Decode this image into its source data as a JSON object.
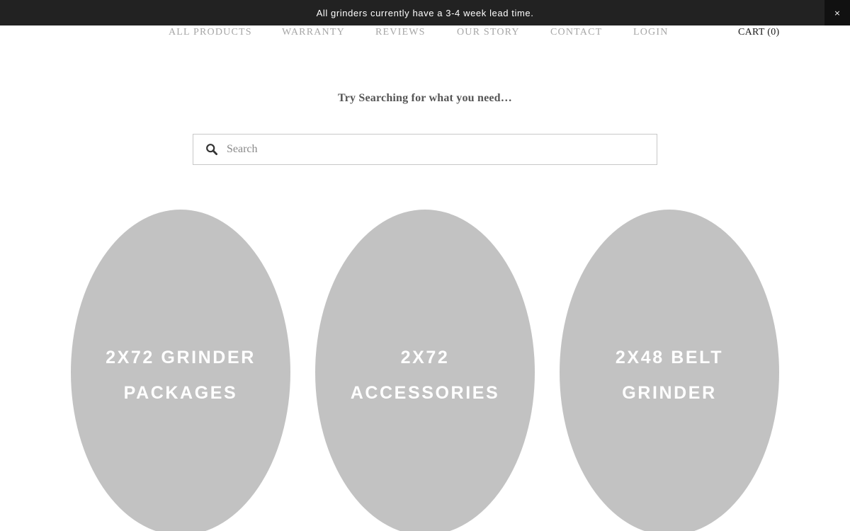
{
  "announcement": {
    "text": "All grinders currently have a 3-4 week lead time.",
    "close_label": "×"
  },
  "nav": {
    "items": [
      {
        "label": "ALL PRODUCTS"
      },
      {
        "label": "WARRANTY"
      },
      {
        "label": "REVIEWS"
      },
      {
        "label": "OUR STORY"
      },
      {
        "label": "CONTACT"
      },
      {
        "label": "LOGIN"
      }
    ],
    "cart_label": "CART (0)"
  },
  "search": {
    "heading": "Try Searching for what you need…",
    "placeholder": "Search",
    "icon": "search-icon"
  },
  "categories": [
    {
      "label": "2X72 GRINDER PACKAGES"
    },
    {
      "label": "2X72 ACCESSORIES"
    },
    {
      "label": "2X48 BELT GRINDER"
    }
  ],
  "colors": {
    "announcement_bg": "#222222",
    "nav_text": "#a6a6a6",
    "category_bg": "#c2c2c2"
  }
}
